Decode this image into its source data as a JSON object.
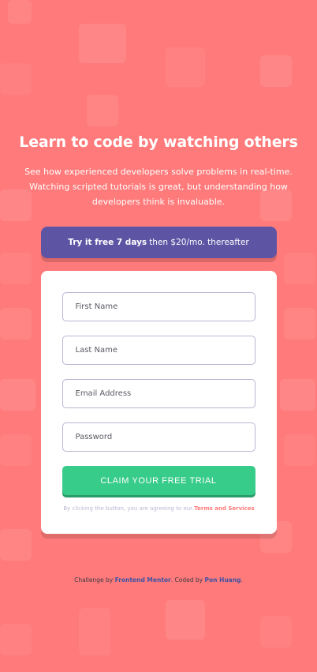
{
  "hero": {
    "headline": "Learn to code by watching others",
    "description": "See how experienced developers solve problems in real-time. Watching scripted tutorials is great, but understanding how developers think is invaluable."
  },
  "trial_banner": {
    "bold_text": "Try it free 7 days",
    "rest_text": "then $20/mo. thereafter"
  },
  "form": {
    "first_name_placeholder": "First Name",
    "last_name_placeholder": "Last Name",
    "email_placeholder": "Email Address",
    "password_placeholder": "Password",
    "submit_label": "CLAIM YOUR FREE TRIAL",
    "terms_prefix": "By clicking the button, you are agreeing to our",
    "terms_link": "Terms and Services"
  },
  "footer": {
    "prefix": "Challenge by",
    "challenge_link": "Frontend Mentor",
    "middle": ". Coded by",
    "author_link": "Pon Huang",
    "suffix": "."
  },
  "colors": {
    "background": "#FF7A7A",
    "banner": "#5E54A4",
    "cta": "#38CC8B",
    "text_dark": "#3D3B48",
    "field_border": "#B9B6D3"
  }
}
